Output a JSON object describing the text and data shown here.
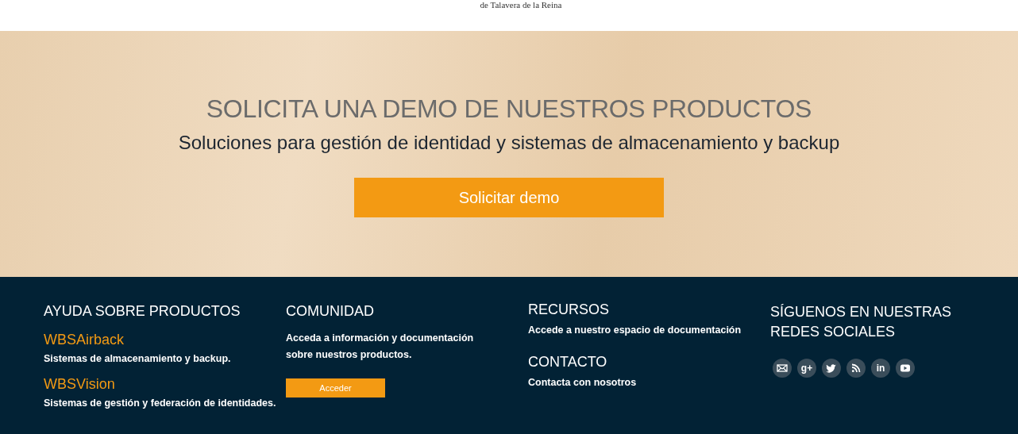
{
  "header": {
    "logo_subtitle": "de Talavera de la Reina"
  },
  "hero": {
    "title": "SOLICITA UNA DEMO DE NUESTROS PRODUCTOS",
    "subtitle": "Soluciones para gestión de identidad y sistemas de almacenamiento y backup",
    "button": "Solicitar demo"
  },
  "footer": {
    "columns": [
      {
        "kind": "products",
        "title": "AYUDA SOBRE PRODUCTOS",
        "products": [
          {
            "name": "WBSAirback",
            "description": "Sistemas de almacenamiento y backup."
          },
          {
            "name": "WBSVision",
            "description": "Sistemas de gestión y federación de identidades."
          }
        ]
      },
      {
        "kind": "text",
        "title": "COMUNIDAD",
        "text": "Acceda a información y documentación sobre nuestros productos.",
        "button": "Acceder"
      },
      {
        "kind": "links",
        "sections": [
          {
            "title": "RECURSOS",
            "link": "Accede a nuestro espacio de documentación"
          },
          {
            "title": "CONTACTO",
            "link": "Contacta con nosotros"
          }
        ]
      },
      {
        "kind": "social",
        "title": "SÍGUENOS EN NUESTRAS REDES SOCIALES",
        "icons": [
          {
            "kind": "mail"
          },
          {
            "kind": "text",
            "text": "g+"
          },
          {
            "kind": "twitter"
          },
          {
            "kind": "rss"
          },
          {
            "kind": "text",
            "text": "in"
          },
          {
            "kind": "youtube"
          }
        ]
      }
    ]
  }
}
